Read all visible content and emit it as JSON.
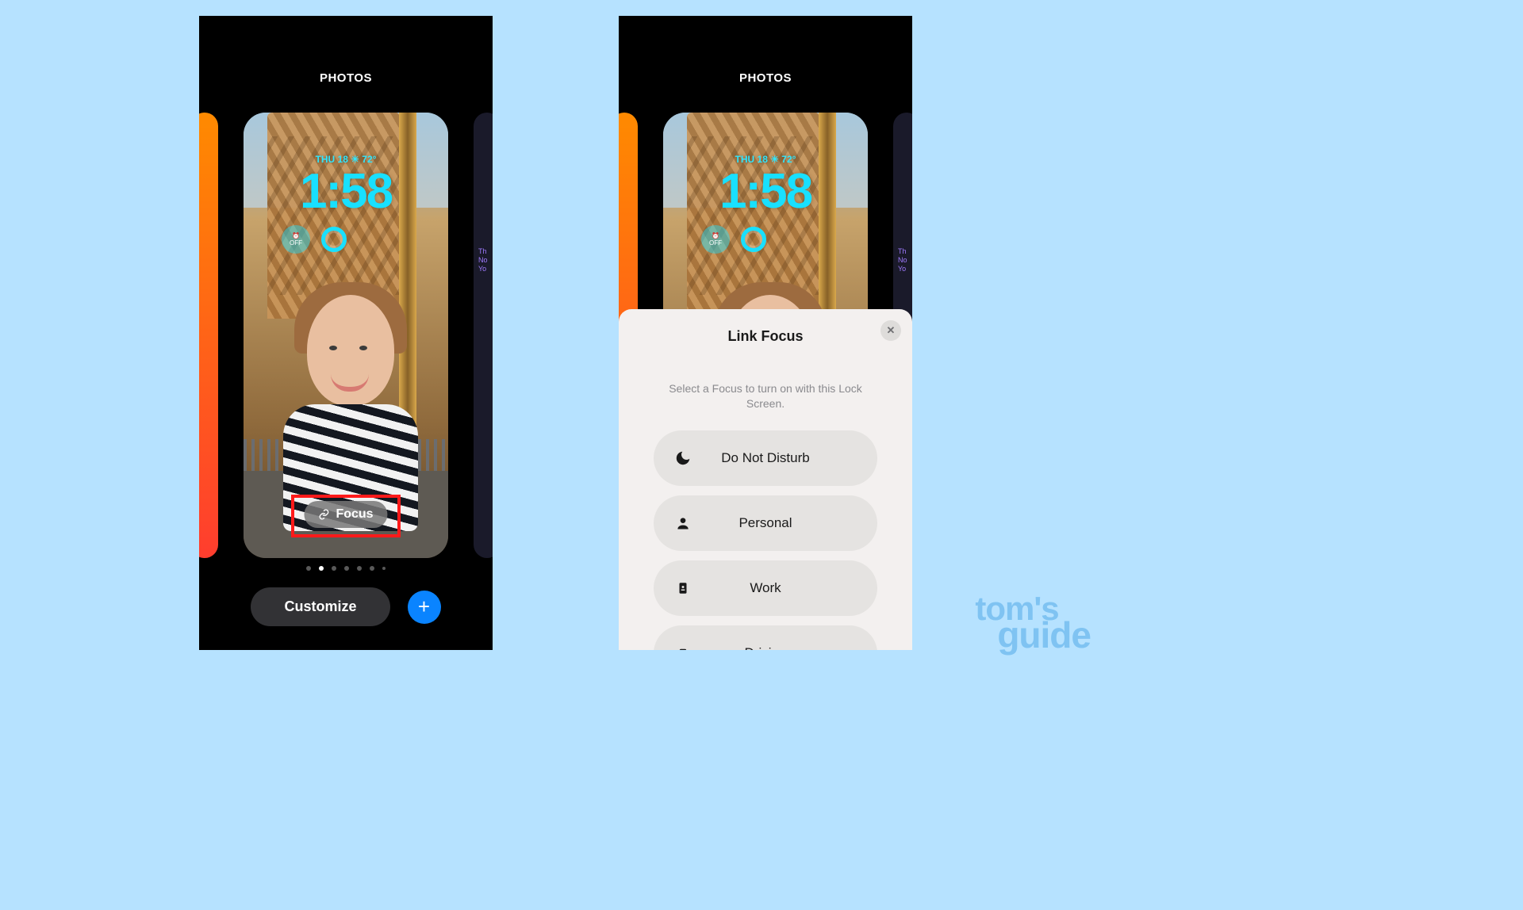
{
  "left": {
    "section_title": "PHOTOS",
    "date_line": "THU 18 ☀︎ 72°",
    "time": "1:58",
    "alarm_widget_text": "OFF",
    "focus_button_label": "Focus",
    "customize_label": "Customize",
    "page_dots_total": 7,
    "page_dots_active_index": 1,
    "peek_right_lines": [
      "Th",
      "No",
      "Yo"
    ]
  },
  "right": {
    "section_title": "PHOTOS",
    "date_line": "THU 18 ☀︎ 72°",
    "time": "1:58",
    "alarm_widget_text": "OFF",
    "peek_right_lines": [
      "Th",
      "No",
      "Yo"
    ],
    "sheet": {
      "title": "Link Focus",
      "description": "Select a Focus to turn on with this Lock Screen.",
      "options": [
        {
          "icon": "moon-icon",
          "label": "Do Not Disturb"
        },
        {
          "icon": "person-icon",
          "label": "Personal"
        },
        {
          "icon": "badge-icon",
          "label": "Work"
        },
        {
          "icon": "car-icon",
          "label": "Driving"
        }
      ]
    }
  },
  "watermark": {
    "line1": "tom's",
    "line2": "guide"
  }
}
